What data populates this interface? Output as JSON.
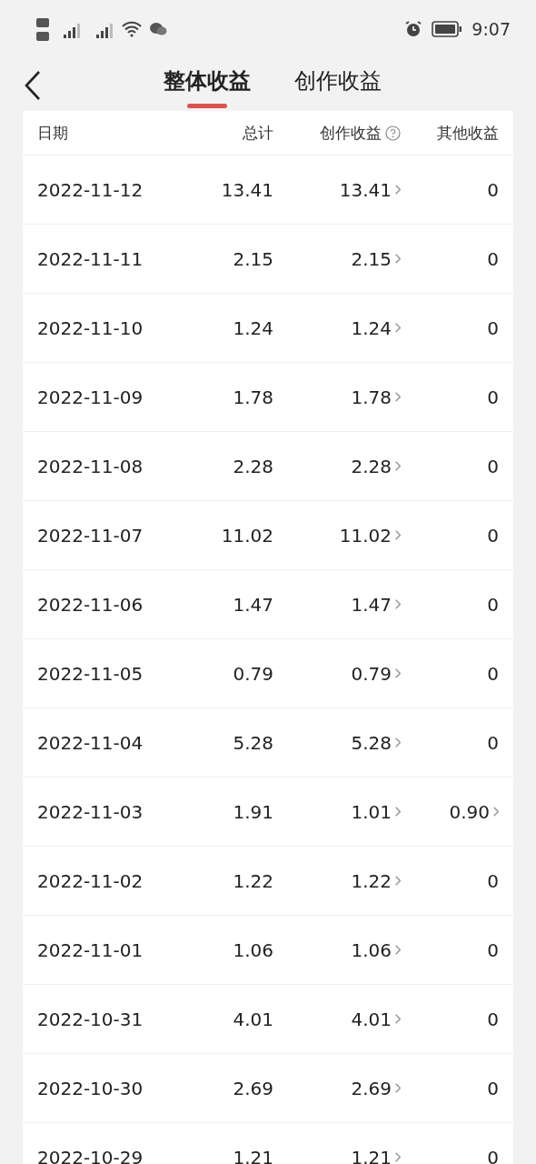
{
  "status_bar": {
    "time": "9:07"
  },
  "tabs": [
    {
      "label": "整体收益",
      "selected": true
    },
    {
      "label": "创作收益",
      "selected": false
    }
  ],
  "table": {
    "columns": [
      "日期",
      "总计",
      "创作收益",
      "其他收益"
    ],
    "rows": [
      {
        "date": "2022-11-12",
        "total": "13.41",
        "creation": "13.41",
        "other": "0",
        "other_link": false
      },
      {
        "date": "2022-11-11",
        "total": "2.15",
        "creation": "2.15",
        "other": "0",
        "other_link": false
      },
      {
        "date": "2022-11-10",
        "total": "1.24",
        "creation": "1.24",
        "other": "0",
        "other_link": false
      },
      {
        "date": "2022-11-09",
        "total": "1.78",
        "creation": "1.78",
        "other": "0",
        "other_link": false
      },
      {
        "date": "2022-11-08",
        "total": "2.28",
        "creation": "2.28",
        "other": "0",
        "other_link": false
      },
      {
        "date": "2022-11-07",
        "total": "11.02",
        "creation": "11.02",
        "other": "0",
        "other_link": false
      },
      {
        "date": "2022-11-06",
        "total": "1.47",
        "creation": "1.47",
        "other": "0",
        "other_link": false
      },
      {
        "date": "2022-11-05",
        "total": "0.79",
        "creation": "0.79",
        "other": "0",
        "other_link": false
      },
      {
        "date": "2022-11-04",
        "total": "5.28",
        "creation": "5.28",
        "other": "0",
        "other_link": false
      },
      {
        "date": "2022-11-03",
        "total": "1.91",
        "creation": "1.01",
        "other": "0.90",
        "other_link": true
      },
      {
        "date": "2022-11-02",
        "total": "1.22",
        "creation": "1.22",
        "other": "0",
        "other_link": false
      },
      {
        "date": "2022-11-01",
        "total": "1.06",
        "creation": "1.06",
        "other": "0",
        "other_link": false
      },
      {
        "date": "2022-10-31",
        "total": "4.01",
        "creation": "4.01",
        "other": "0",
        "other_link": false
      },
      {
        "date": "2022-10-30",
        "total": "2.69",
        "creation": "2.69",
        "other": "0",
        "other_link": false
      },
      {
        "date": "2022-10-29",
        "total": "1.21",
        "creation": "1.21",
        "other": "0",
        "other_link": false
      }
    ]
  }
}
